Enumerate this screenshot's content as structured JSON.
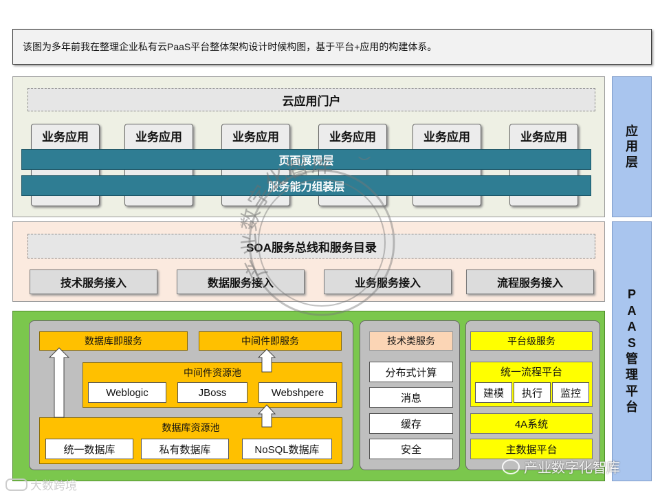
{
  "caption": "该图为多年前我在整理企业私有云PaaS平台整体架构设计时候构图，基于平台+应用的构建体系。",
  "app_layer": {
    "portal": "云应用门户",
    "biz_apps": [
      "业务应用",
      "业务应用",
      "业务应用",
      "业务应用",
      "业务应用",
      "业务应用"
    ],
    "presentation": "页面展现层",
    "assembly": "服务能力组装层",
    "side_label": "应\n用\n层"
  },
  "soa_layer": {
    "bus": "SOA服务总线和服务目录",
    "access": [
      "技术服务接入",
      "数据服务接入",
      "业务服务接入",
      "流程服务接入"
    ]
  },
  "paas_side_label": "P\nA\nA\nS\n管\n理\n平\n台",
  "resource": {
    "db_service": "数据库即服务",
    "mw_service": "中间件即服务",
    "mw_pool": "中间件资源池",
    "mw_items": [
      "Weblogic",
      "JBoss",
      "Webshpere"
    ],
    "db_pool": "数据库资源池",
    "db_items": [
      "统一数据库",
      "私有数据库",
      "NoSQL数据库"
    ]
  },
  "tech": {
    "title": "技术类服务",
    "items": [
      "分布式计算",
      "消息",
      "缓存",
      "安全"
    ]
  },
  "platform": {
    "title": "平台级服务",
    "process": "统一流程平台",
    "process_items": [
      "建模",
      "执行",
      "监控"
    ],
    "fourA": "4A系统",
    "mdm": "主数据平台"
  },
  "watermarks": {
    "stamp": "产业数字化智库",
    "bottom_right": "产业数字化智库",
    "bottom_left": "大数跨境"
  }
}
